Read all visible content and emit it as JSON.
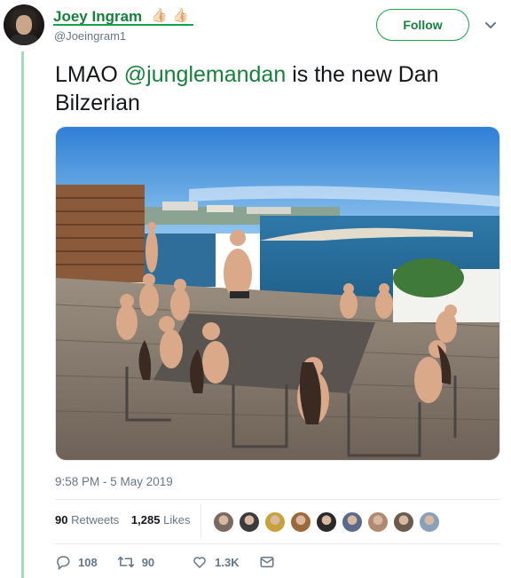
{
  "author": {
    "name": "Joey Ingram",
    "emoji": [
      "👍🏻",
      "👍🏻"
    ],
    "handle": "@Joeingram1",
    "avatar_icon": "profile-photo"
  },
  "follow_label": "Follow",
  "tweet": {
    "prefix": "LMAO ",
    "mention": "@junglemandan",
    "suffix": " is the new Dan Bilzerian",
    "image_icon": "photo-rooftop-group"
  },
  "timestamp": "9:58 PM - 5 May 2019",
  "stats": {
    "retweets_count": "90",
    "retweets_label": "Retweets",
    "likes_count": "1,285",
    "likes_label": "Likes",
    "liker_avatars": [
      "#7a6a62",
      "#3b3b3b",
      "#c8a13a",
      "#9a6a3a",
      "#2a2a2a",
      "#5b6a8a",
      "#b08a70",
      "#6a5a50",
      "#8aa0b8"
    ]
  },
  "actions": {
    "reply_count": "108",
    "retweet_count": "90",
    "like_count": "1.3K",
    "reply_icon": "reply-icon",
    "retweet_icon": "retweet-icon",
    "like_icon": "heart-icon",
    "dm_icon": "mail-icon"
  },
  "colors": {
    "accent": "#17803d",
    "thread_line": "#a4d9b9",
    "muted": "#657786"
  }
}
